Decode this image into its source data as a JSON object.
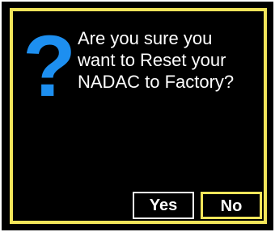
{
  "dialog": {
    "icon": "question-mark-icon",
    "icon_glyph": "?",
    "icon_color": "#1d8ff0",
    "message_lines": [
      "Are you sure you",
      "want to Reset your",
      "NADAC to Factory?"
    ],
    "accent_color": "#f2e55a",
    "buttons": {
      "yes_label": "Yes",
      "no_label": "No",
      "focused": "No"
    }
  }
}
